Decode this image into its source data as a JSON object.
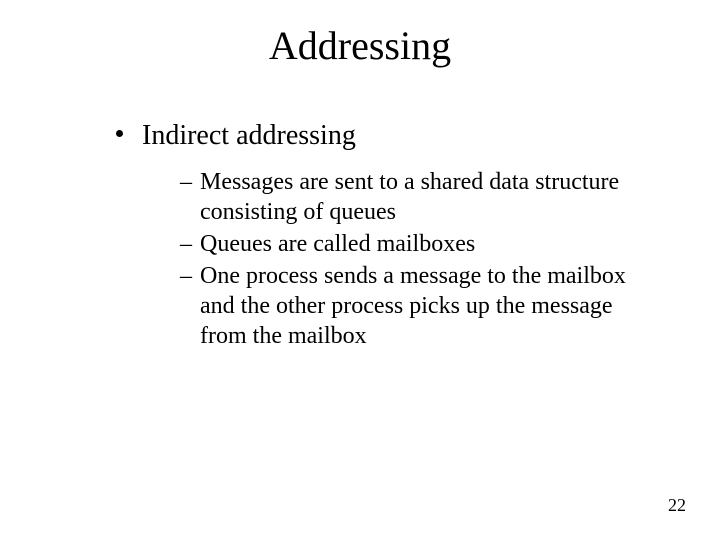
{
  "slide": {
    "title": "Addressing",
    "level1": "Indirect addressing",
    "level2": [
      "Messages are sent to a shared data structure consisting of queues",
      "Queues are called mailboxes",
      "One process sends a message to the mailbox and the other process picks up the message from the mailbox"
    ],
    "page_number": "22"
  }
}
